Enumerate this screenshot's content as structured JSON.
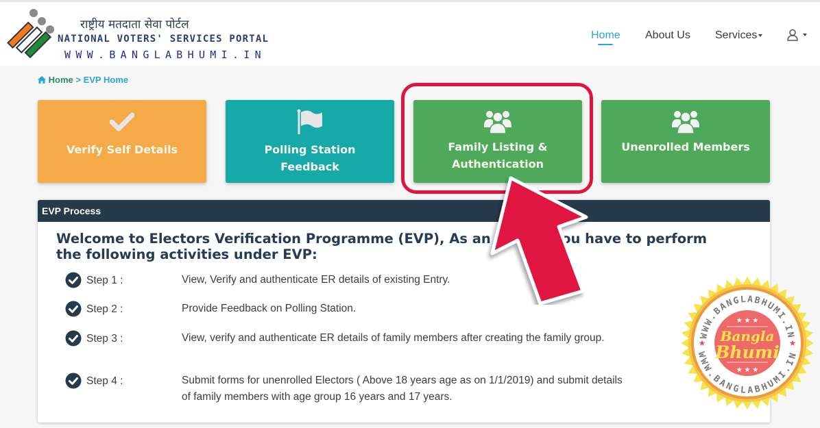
{
  "header": {
    "logo_icon": "evm-ballot-logo-icon",
    "title_hindi": "राष्ट्रीय मतदाता सेवा पोर्टल",
    "title_english": "NATIONAL VOTERS' SERVICES PORTAL",
    "watermark_url": "WWW.BANGLABHUMI.IN"
  },
  "nav": {
    "items": [
      {
        "label": "Home",
        "active": true
      },
      {
        "label": "About Us",
        "active": false
      },
      {
        "label": "Services",
        "active": false,
        "dropdown": true
      }
    ],
    "user_icon": "user-icon",
    "colors": {
      "active": "#2aa5d8",
      "default": "#3a3a3a"
    }
  },
  "breadcrumb": {
    "home_icon": "home-icon",
    "home": "Home",
    "separator": ">",
    "current": "EVP Home"
  },
  "tiles": [
    {
      "label": "Verify Self Details",
      "icon": "checkmark-icon",
      "color": "#f3aa47"
    },
    {
      "label": "Polling Station Feedback",
      "icon": "flag-icon",
      "color": "#15a9a8"
    },
    {
      "label": "Family Listing & Authentication",
      "icon": "users-icon",
      "color": "#4fa95a",
      "highlighted": true
    },
    {
      "label": "Unenrolled Members",
      "icon": "users-icon",
      "color": "#4fa95a"
    }
  ],
  "panel": {
    "header": "EVP Process",
    "welcome": "Welcome to Electors Verification Programme (EVP), As an elector you have to perform the following activities under EVP:",
    "steps": [
      {
        "label": "Step 1 :",
        "text": "View, Verify and authenticate ER details of existing Entry."
      },
      {
        "label": "Step 2 :",
        "text": "Provide Feedback on Polling Station."
      },
      {
        "label": "Step 3 :",
        "text": "View, verify and authenticate ER details of family members after creating the family group."
      },
      {
        "label": "Step 4 :",
        "text": "Submit forms for unenrolled Electors ( Above 18 years age as on 1/1/2019) and submit details of family members with age group 16 years and 17 years."
      }
    ]
  },
  "overlay": {
    "highlight_color": "#e0143f",
    "arrow_color": "#e0143f",
    "badge": {
      "ring_text": "WWW.BANGLABHUMI.IN",
      "line1": "Bangla",
      "line2": "Bhumi"
    }
  }
}
